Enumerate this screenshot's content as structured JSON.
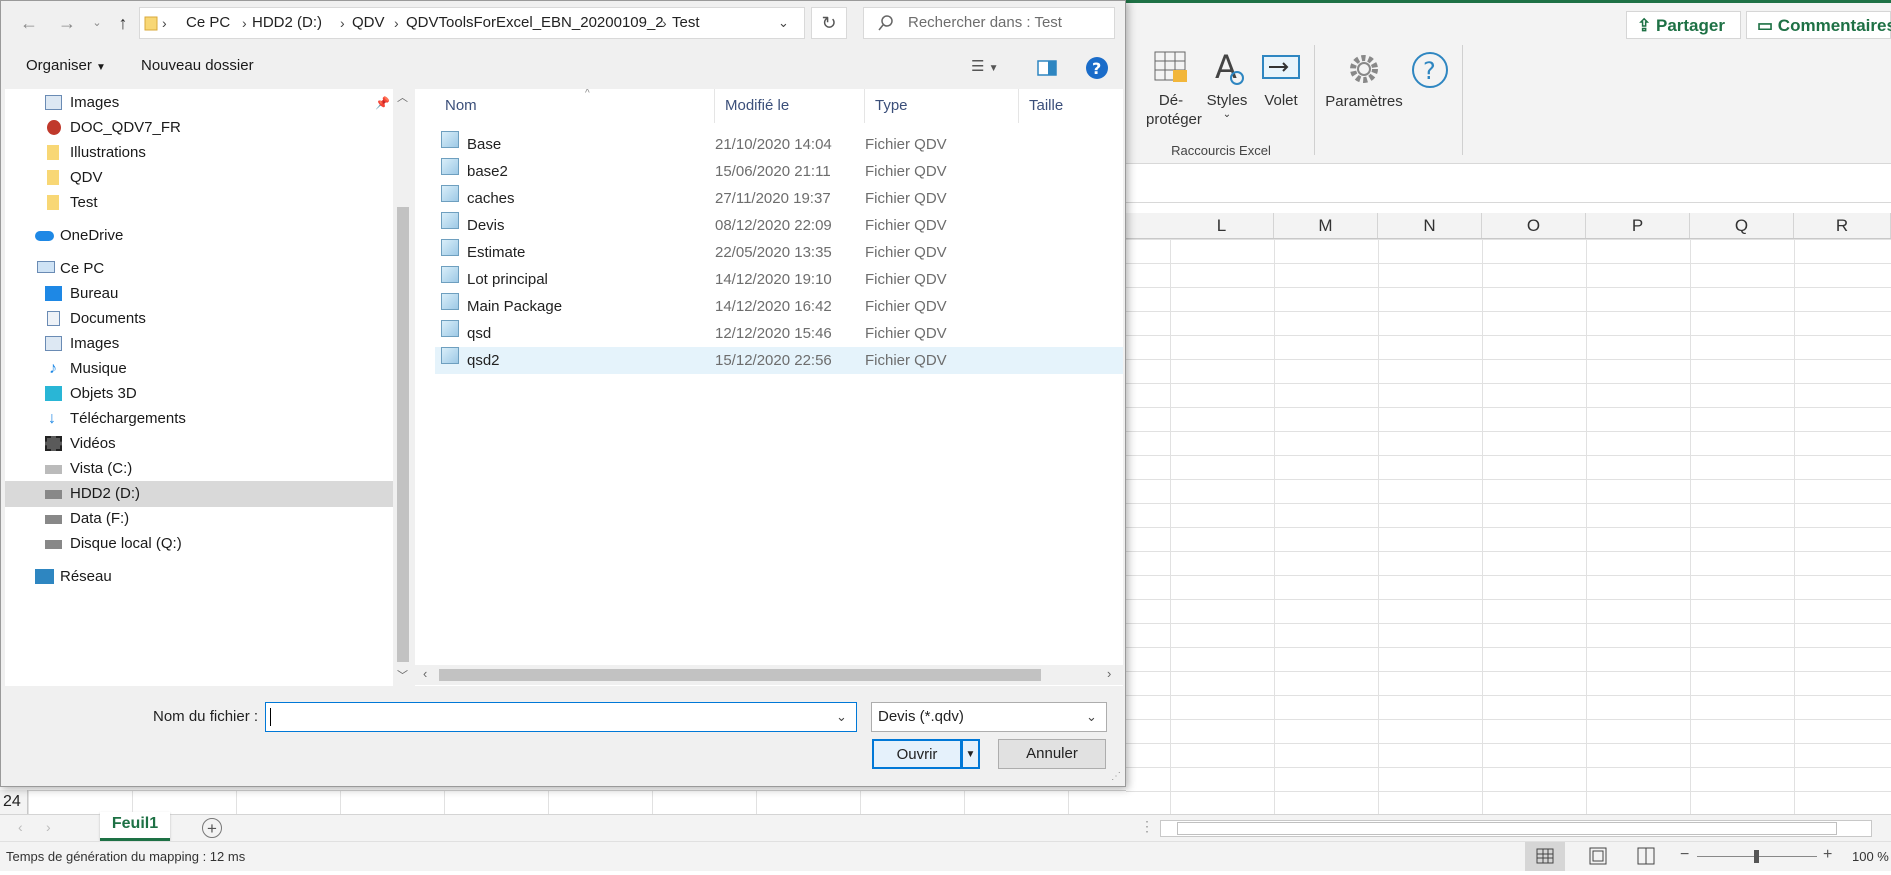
{
  "dialog": {
    "breadcrumb": [
      "Ce PC",
      "HDD2 (D:)",
      "QDV",
      "QDVToolsForExcel_EBN_20200109_2",
      "Test"
    ],
    "search_placeholder": "Rechercher dans : Test",
    "toolbar": {
      "organize": "Organiser",
      "new_folder": "Nouveau dossier"
    },
    "nav": {
      "quick": [
        "Images",
        "DOC_QDV7_FR",
        "Illustrations",
        "QDV",
        "Test"
      ],
      "onedrive": "OneDrive",
      "this_pc": "Ce PC",
      "pc_items": [
        "Bureau",
        "Documents",
        "Images",
        "Musique",
        "Objets 3D",
        "Téléchargements",
        "Vidéos",
        "Vista (C:)",
        "HDD2 (D:)",
        "Data (F:)",
        "Disque local (Q:)"
      ],
      "network": "Réseau"
    },
    "columns": {
      "name": "Nom",
      "modified": "Modifié le",
      "type": "Type",
      "size": "Taille"
    },
    "files": [
      {
        "name": "Base",
        "modified": "21/10/2020 14:04",
        "type": "Fichier QDV"
      },
      {
        "name": "base2",
        "modified": "15/06/2020 21:11",
        "type": "Fichier QDV"
      },
      {
        "name": "caches",
        "modified": "27/11/2020 19:37",
        "type": "Fichier QDV"
      },
      {
        "name": "Devis",
        "modified": "08/12/2020 22:09",
        "type": "Fichier QDV"
      },
      {
        "name": "Estimate",
        "modified": "22/05/2020 13:35",
        "type": "Fichier QDV"
      },
      {
        "name": "Lot principal",
        "modified": "14/12/2020 19:10",
        "type": "Fichier QDV"
      },
      {
        "name": "Main Package",
        "modified": "14/12/2020 16:42",
        "type": "Fichier QDV"
      },
      {
        "name": "qsd",
        "modified": "12/12/2020 15:46",
        "type": "Fichier QDV"
      },
      {
        "name": "qsd2",
        "modified": "15/12/2020 22:56",
        "type": "Fichier QDV"
      }
    ],
    "filename_label": "Nom du fichier :",
    "filename_value": "",
    "filetype": "Devis (*.qdv)",
    "open": "Ouvrir",
    "cancel": "Annuler"
  },
  "excel": {
    "share": "Partager",
    "comments": "Commentaires",
    "ribbon": {
      "unprotect_1": "Dé-",
      "unprotect_2": "protéger",
      "styles": "Styles",
      "pane": "Volet",
      "settings": "Paramètres",
      "group_label": "Raccourcis Excel"
    },
    "columns": [
      "L",
      "M",
      "N",
      "O",
      "P",
      "Q",
      "R"
    ],
    "row_number": "24",
    "sheet_tab": "Feuil1",
    "status": "Temps de génération du mapping : 12 ms",
    "zoom": "100 %",
    "accent": "#1e7145"
  }
}
